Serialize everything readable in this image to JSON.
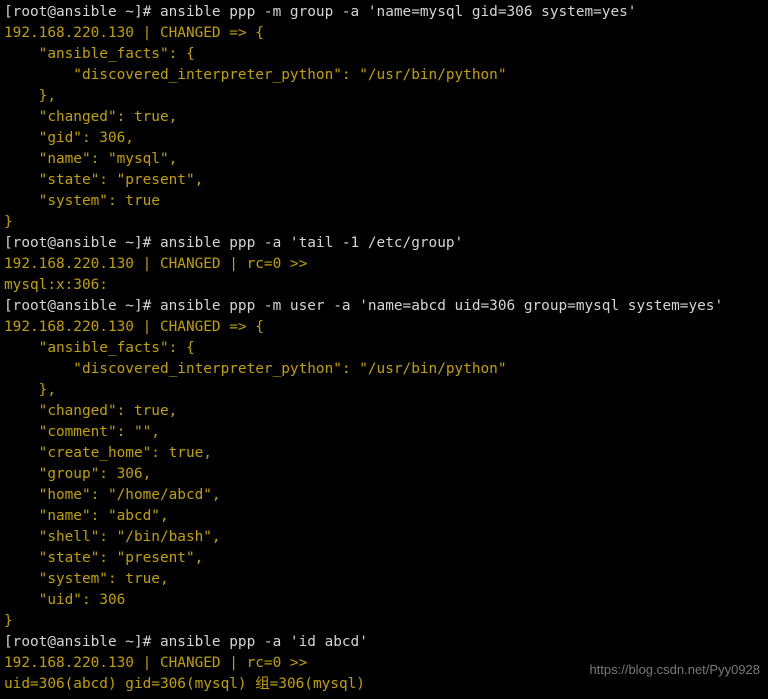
{
  "terminal": {
    "title": "root@ansible terminal",
    "colors": {
      "background": "#000000",
      "prompt_text": "#d4d4d4",
      "output_text": "#bfa000",
      "watermark_text": "#8f8f8f"
    },
    "lines": [
      {
        "kind": "prompt",
        "text": "[root@ansible ~]# ansible ppp -m group -a 'name=mysql gid=306 system=yes'"
      },
      {
        "kind": "output",
        "text": "192.168.220.130 | CHANGED => {"
      },
      {
        "kind": "output",
        "text": "    \"ansible_facts\": {"
      },
      {
        "kind": "output",
        "text": "        \"discovered_interpreter_python\": \"/usr/bin/python\""
      },
      {
        "kind": "output",
        "text": "    },"
      },
      {
        "kind": "output",
        "text": "    \"changed\": true,"
      },
      {
        "kind": "output",
        "text": "    \"gid\": 306,"
      },
      {
        "kind": "output",
        "text": "    \"name\": \"mysql\","
      },
      {
        "kind": "output",
        "text": "    \"state\": \"present\","
      },
      {
        "kind": "output",
        "text": "    \"system\": true"
      },
      {
        "kind": "output",
        "text": "}"
      },
      {
        "kind": "prompt",
        "text": "[root@ansible ~]# ansible ppp -a 'tail -1 /etc/group'"
      },
      {
        "kind": "output",
        "text": "192.168.220.130 | CHANGED | rc=0 >>"
      },
      {
        "kind": "output",
        "text": "mysql:x:306:"
      },
      {
        "kind": "prompt",
        "text": "[root@ansible ~]# ansible ppp -m user -a 'name=abcd uid=306 group=mysql system=yes'"
      },
      {
        "kind": "output",
        "text": "192.168.220.130 | CHANGED => {"
      },
      {
        "kind": "output",
        "text": "    \"ansible_facts\": {"
      },
      {
        "kind": "output",
        "text": "        \"discovered_interpreter_python\": \"/usr/bin/python\""
      },
      {
        "kind": "output",
        "text": "    },"
      },
      {
        "kind": "output",
        "text": "    \"changed\": true,"
      },
      {
        "kind": "output",
        "text": "    \"comment\": \"\","
      },
      {
        "kind": "output",
        "text": "    \"create_home\": true,"
      },
      {
        "kind": "output",
        "text": "    \"group\": 306,"
      },
      {
        "kind": "output",
        "text": "    \"home\": \"/home/abcd\","
      },
      {
        "kind": "output",
        "text": "    \"name\": \"abcd\","
      },
      {
        "kind": "output",
        "text": "    \"shell\": \"/bin/bash\","
      },
      {
        "kind": "output",
        "text": "    \"state\": \"present\","
      },
      {
        "kind": "output",
        "text": "    \"system\": true,"
      },
      {
        "kind": "output",
        "text": "    \"uid\": 306"
      },
      {
        "kind": "output",
        "text": "}"
      },
      {
        "kind": "prompt",
        "text": "[root@ansible ~]# ansible ppp -a 'id abcd'"
      },
      {
        "kind": "output",
        "text": "192.168.220.130 | CHANGED | rc=0 >>"
      },
      {
        "kind": "output",
        "text": "uid=306(abcd) gid=306(mysql) 组=306(mysql)"
      }
    ]
  },
  "watermark": {
    "text": "https://blog.csdn.net/Pyy0928"
  }
}
